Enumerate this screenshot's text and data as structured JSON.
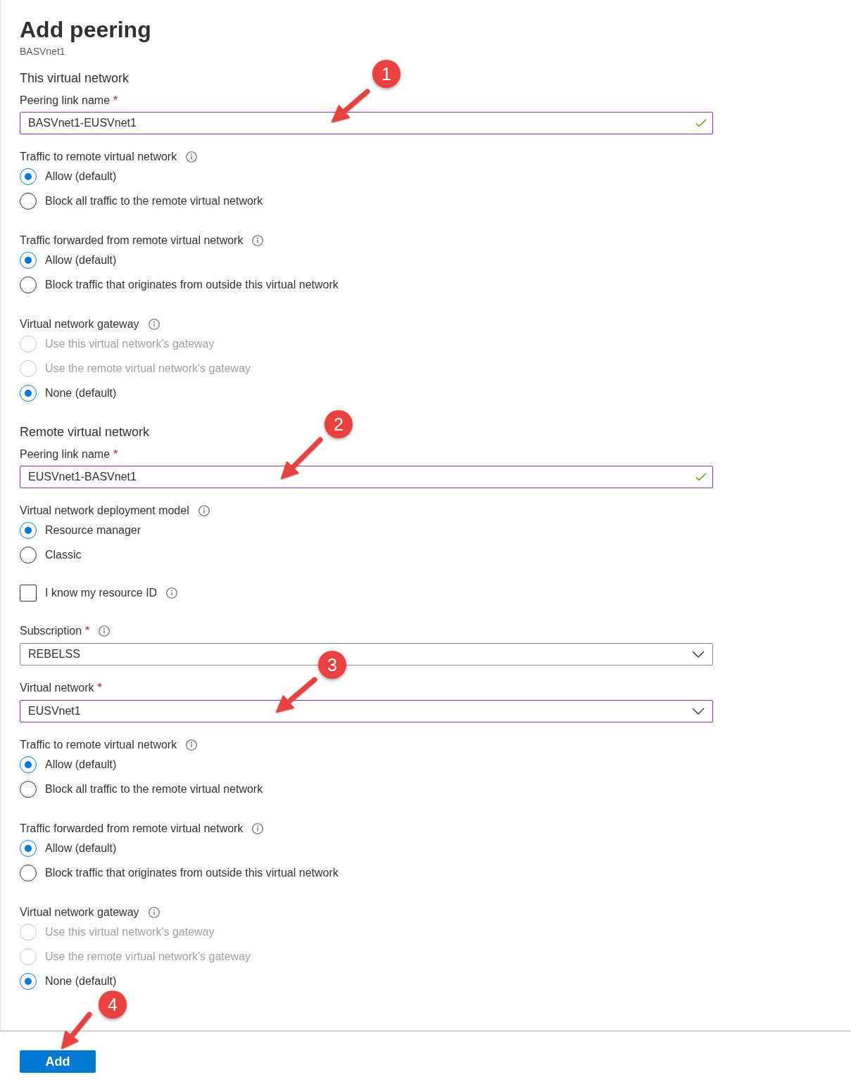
{
  "panel": {
    "title": "Add peering",
    "subtitle": "BASVnet1"
  },
  "sections": [
    {
      "heading": "This virtual network",
      "items": [
        {
          "kind": "text_input",
          "label": "Peering link name",
          "required_mark": "*",
          "value": "BASVnet1-EUSVnet1",
          "edited": true,
          "valid": true,
          "callout": "1"
        },
        {
          "kind": "radio_group",
          "label": "Traffic to remote virtual network",
          "info": true,
          "options": [
            {
              "label": "Allow (default)",
              "selected": true,
              "disabled": false
            },
            {
              "label": "Block all traffic to the remote virtual network",
              "selected": false,
              "disabled": false
            }
          ]
        },
        {
          "kind": "radio_group",
          "label": "Traffic forwarded from remote virtual network",
          "info": true,
          "options": [
            {
              "label": "Allow (default)",
              "selected": true,
              "disabled": false
            },
            {
              "label": "Block traffic that originates from outside this virtual network",
              "selected": false,
              "disabled": false
            }
          ]
        },
        {
          "kind": "radio_group",
          "label": "Virtual network gateway",
          "info": true,
          "options": [
            {
              "label": "Use this virtual network's gateway",
              "selected": false,
              "disabled": true
            },
            {
              "label": "Use the remote virtual network's gateway",
              "selected": false,
              "disabled": true
            },
            {
              "label": "None (default)",
              "selected": true,
              "disabled": false
            }
          ]
        }
      ]
    },
    {
      "heading": "Remote virtual network",
      "items": [
        {
          "kind": "text_input",
          "label": "Peering link name",
          "required_mark": "*",
          "value": "EUSVnet1-BASVnet1",
          "edited": true,
          "valid": true,
          "callout": "2"
        },
        {
          "kind": "radio_group",
          "label": "Virtual network deployment model",
          "info": true,
          "options": [
            {
              "label": "Resource manager",
              "selected": true,
              "disabled": false
            },
            {
              "label": "Classic",
              "selected": false,
              "disabled": false
            }
          ]
        },
        {
          "kind": "checkbox",
          "label": "I know my resource ID",
          "checked": false,
          "info": true
        },
        {
          "kind": "dropdown",
          "label": "Subscription",
          "required_mark": "*",
          "info": true,
          "value": "REBELSS",
          "edited": false
        },
        {
          "kind": "dropdown",
          "label": "Virtual network",
          "required_mark": "*",
          "value": "EUSVnet1",
          "edited": true,
          "callout": "3"
        },
        {
          "kind": "radio_group",
          "label": "Traffic to remote virtual network",
          "info": true,
          "options": [
            {
              "label": "Allow (default)",
              "selected": true,
              "disabled": false
            },
            {
              "label": "Block all traffic to the remote virtual network",
              "selected": false,
              "disabled": false
            }
          ]
        },
        {
          "kind": "radio_group",
          "label": "Traffic forwarded from remote virtual network",
          "info": true,
          "options": [
            {
              "label": "Allow (default)",
              "selected": true,
              "disabled": false
            },
            {
              "label": "Block traffic that originates from outside this virtual network",
              "selected": false,
              "disabled": false
            }
          ]
        },
        {
          "kind": "radio_group",
          "label": "Virtual network gateway",
          "info": true,
          "options": [
            {
              "label": "Use this virtual network's gateway",
              "selected": false,
              "disabled": true
            },
            {
              "label": "Use the remote virtual network's gateway",
              "selected": false,
              "disabled": true
            },
            {
              "label": "None (default)",
              "selected": true,
              "disabled": false
            }
          ]
        }
      ]
    }
  ],
  "footer": {
    "button": {
      "label": "Add",
      "callout": "4"
    }
  }
}
